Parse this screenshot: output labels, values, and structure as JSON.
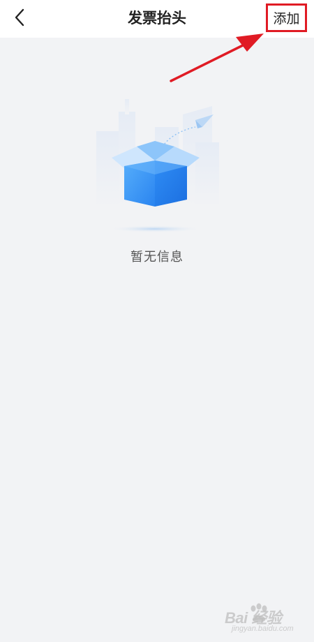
{
  "header": {
    "title": "发票抬头",
    "back_icon": "chevron-left-icon",
    "add_label": "添加"
  },
  "empty_state": {
    "message": "暂无信息",
    "illustration": "empty-box-illustration"
  },
  "watermark": {
    "brand": "Bai 经验",
    "sub": "jingyan.baidu.com"
  },
  "colors": {
    "highlight_red": "#e01b24",
    "accent_blue": "#2f8df5",
    "page_bg": "#f2f3f5"
  }
}
